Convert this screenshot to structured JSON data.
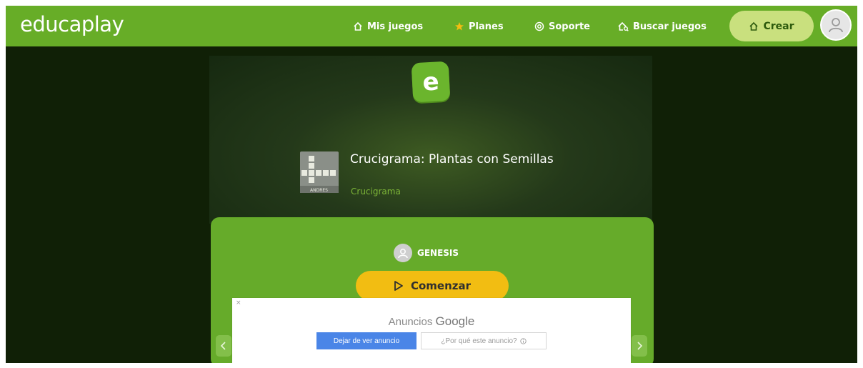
{
  "header": {
    "logo": "educaplay",
    "nav": {
      "my_games": "Mis juegos",
      "plans": "Planes",
      "support": "Soporte",
      "search_games": "Buscar juegos"
    },
    "create": "Crear"
  },
  "game": {
    "title": "Crucigrama: Plantas con Semillas",
    "type": "Crucigrama",
    "thumb_caption": "ANDRES",
    "author": "GENESIS",
    "start": "Comenzar"
  },
  "ad": {
    "label": "Anuncios",
    "brand": "Google",
    "stop": "Dejar de ver anuncio",
    "why": "¿Por qué este anuncio?"
  },
  "colors": {
    "header_green": "#67ad27",
    "panel_green": "#66ab2a",
    "start_yellow": "#f2bd12",
    "background": "#102006"
  },
  "icons": [
    "home-icon",
    "star-icon",
    "support-icon",
    "search-games-icon",
    "create-icon",
    "user-icon",
    "play-icon",
    "info-icon"
  ]
}
